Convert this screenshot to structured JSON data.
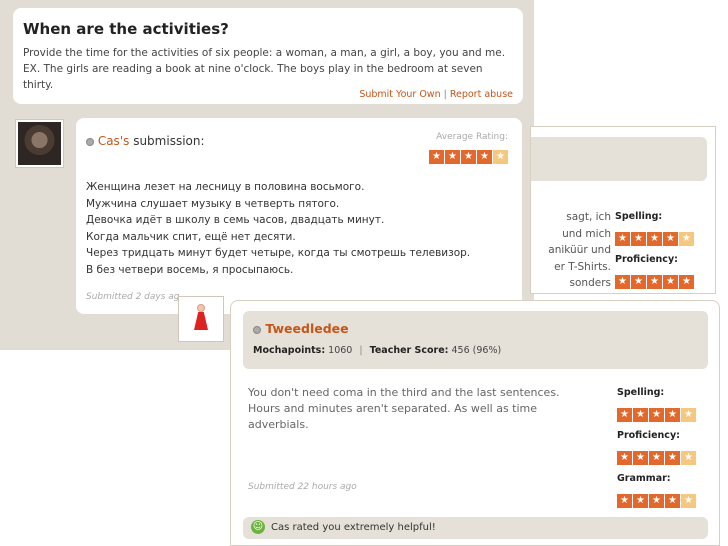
{
  "prompt": {
    "title": "When are the activities?",
    "text": "Provide the time for the activities of six people: a woman, a man, a girl, a boy, you and me. EX. The girls are reading a book at nine o'clock. The boys play in the bedroom at seven thirty.",
    "submit_link": "Submit Your Own",
    "report_link": "Report abuse"
  },
  "cas_submission": {
    "author": "Cas's",
    "header_suffix": " submission:",
    "average_rating_label": "Average Rating:",
    "average_rating_stars": 4,
    "lines": [
      "Женщина лезет на лесницу в половина восьмого.",
      "Мужчина слушает музыку в четверть пятого.",
      "Девочка идёт в школу в семь часов, двадцать минут.",
      "Когда мальчик спит, ещё нет десяти.",
      "Через тридцать минут будет четыре, когда ты смотрешь телевизор.",
      "В без четвери восемь, я просыпаюсь."
    ],
    "submitted": "Submitted 2 days ag"
  },
  "background_card": {
    "lines": [
      "sagt, ich",
      "und mich",
      "aniküür und",
      "er T-Shirts.",
      "sonders"
    ],
    "ratings": [
      {
        "label": "Spelling:",
        "stars": 4
      },
      {
        "label": "Proficiency:",
        "stars": 5
      }
    ]
  },
  "tweedledee": {
    "name": "Tweedledee",
    "mochapoints_label": "Mochapoints:",
    "mochapoints": "1060",
    "teacher_score_label": "Teacher Score:",
    "teacher_score": "456 (96%)",
    "comment": "You don't need coma in the third and the last sentences. Hours and minutes aren't separated. As well as time adverbials.",
    "ratings": [
      {
        "label": "Spelling:",
        "stars": 4
      },
      {
        "label": "Proficiency:",
        "stars": 4
      },
      {
        "label": "Grammar:",
        "stars": 4
      }
    ],
    "submitted": "Submitted 22 hours ago",
    "footer": "Cas rated you extremely helpful!"
  },
  "colors": {
    "accent": "#c4561a",
    "star_on": "#e2692b",
    "star_off": "#f6c77e",
    "panel": "#e6e1d8"
  }
}
